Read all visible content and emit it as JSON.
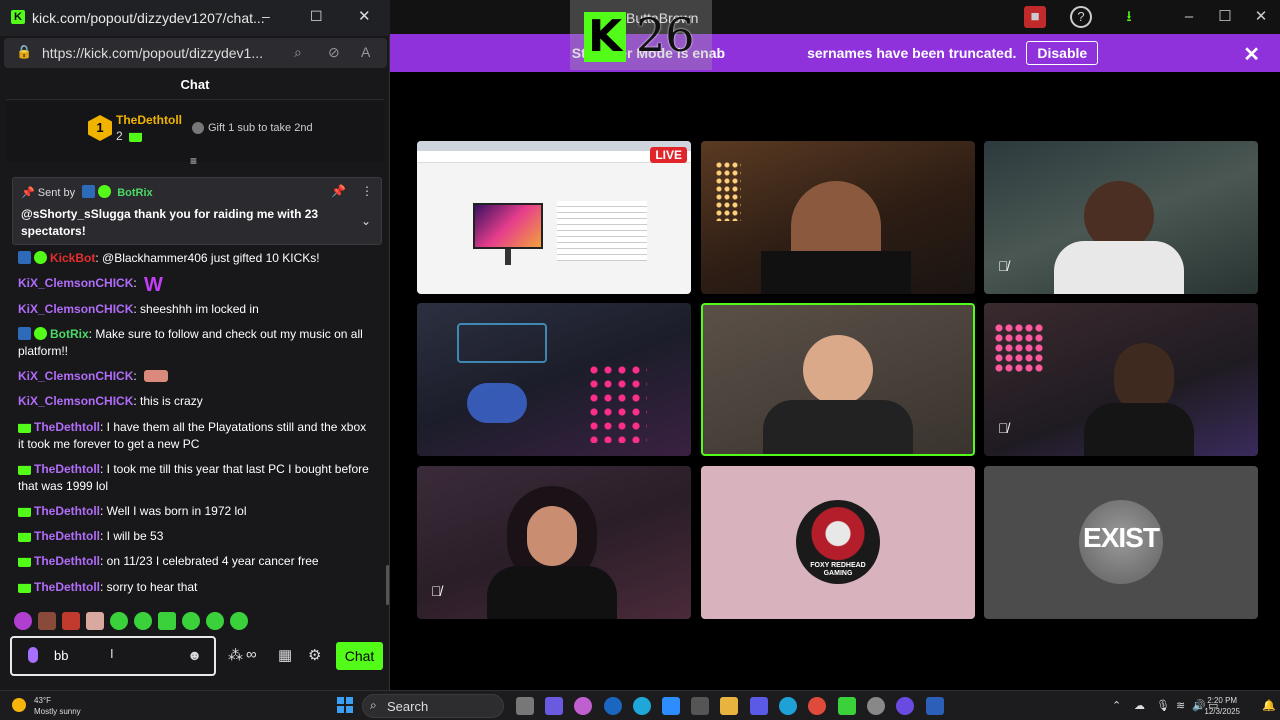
{
  "popout": {
    "window_title": "kick.com/popout/dizzydev1207/chat...",
    "url": "https://kick.com/popout/dizzydev1...",
    "chat_header": "Chat",
    "leaderboard": {
      "rank": "1",
      "user": "TheDethtoll",
      "count": "2",
      "gift_text": "Gift 1 sub to take 2nd"
    },
    "pinned": {
      "sent_by_label": "Sent by",
      "sender": "BotRix",
      "message": "@sShorty_sSlugga thank you for raiding me with 23 spectators!"
    },
    "messages": [
      {
        "user": "KickBot",
        "text": ": @Blackhammer406 just gifted 10 KICKs!",
        "color": "red"
      },
      {
        "user": "KiX_ClemsonCHICK",
        "text": ":",
        "color": "purple",
        "emote": "W"
      },
      {
        "user": "KiX_ClemsonCHICK",
        "text": ": sheeshhh im locked in",
        "color": "purple"
      },
      {
        "user": "BotRix",
        "text": ": Make sure to follow and check out my music on all platform!!",
        "color": "green"
      },
      {
        "user": "KiX_ClemsonCHICK",
        "text": ":",
        "color": "purple"
      },
      {
        "user": "KiX_ClemsonCHICK",
        "text": ": this is crazy",
        "color": "purple"
      },
      {
        "user": "TheDethtoll",
        "text": ": I have them all the Playatations still and the xbox it took me forever to get a new PC",
        "color": "purple"
      },
      {
        "user": "TheDethtoll",
        "text": ": I took me till this year that last PC I bought before that was 1999 lol",
        "color": "purple"
      },
      {
        "user": "TheDethtoll",
        "text": ": Well I was born in 1972 lol",
        "color": "purple"
      },
      {
        "user": "TheDethtoll",
        "text": ": I will be 53",
        "color": "purple"
      },
      {
        "user": "TheDethtoll",
        "text": ": on 11/23 I celebrated 4 year cancer free",
        "color": "purple"
      },
      {
        "user": "TheDethtoll",
        "text": ": sorry to hear that",
        "color": "purple"
      }
    ],
    "input_value": "bb",
    "send_label": "Chat"
  },
  "app": {
    "overlay_name": "ButtaBrown",
    "overlay_number": "26",
    "notice": "Streamer Mode is enabled. Usernames have been truncated.",
    "notice_visible": "Streamer Mode is enab",
    "notice_tail": "sernames have been truncated.",
    "disable_label": "Disable",
    "live_badge": "LIVE",
    "tiles": [
      {
        "label": "screen-share",
        "muted": false
      },
      {
        "label": "participant-2",
        "muted": false
      },
      {
        "label": "participant-3",
        "muted": true
      },
      {
        "label": "participant-4",
        "muted": false
      },
      {
        "label": "participant-5",
        "muted": false,
        "speaking": true
      },
      {
        "label": "participant-6",
        "muted": true
      },
      {
        "label": "participant-7",
        "muted": true
      },
      {
        "label": "participant-8",
        "logo_text": "FOXY REDHEAD GAMING",
        "muted": false
      },
      {
        "label": "participant-9",
        "logo_text": "EXIST",
        "muted": false
      }
    ],
    "colors": {
      "banner": "#8f32db",
      "kick_green": "#53fc18"
    }
  },
  "taskbar": {
    "temp": "43°F",
    "weather": "Mostly sunny",
    "search_placeholder": "Search",
    "time": "2:20 PM",
    "date": "12/3/2025"
  }
}
